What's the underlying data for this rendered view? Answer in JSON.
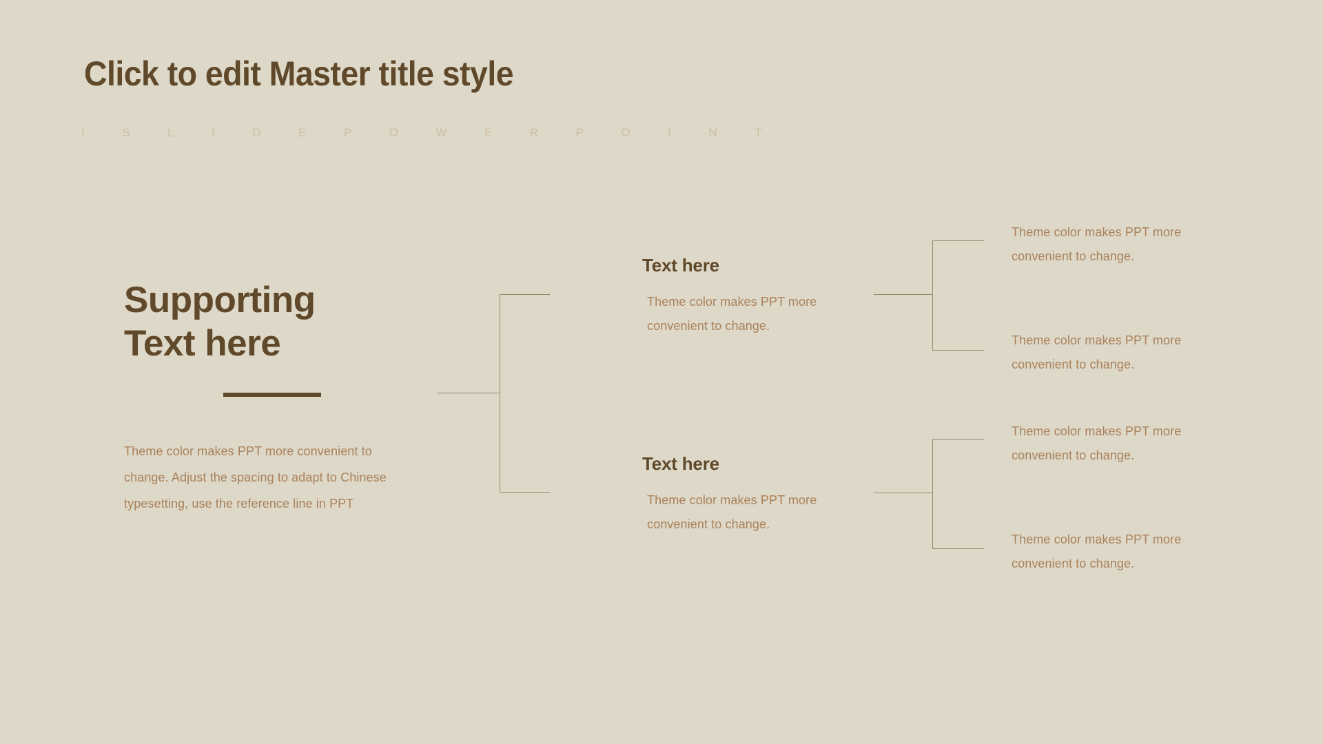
{
  "slide": {
    "background_color": "#ded8c8",
    "title": "Click to edit Master title style",
    "brand_letters": "ISLIDEPOWERPOINT"
  },
  "colors": {
    "heading": "#5f492a",
    "body": "#a9825c",
    "brand_letters": "#cdbda4",
    "connector_line": "#97896b"
  },
  "hero": {
    "title_line_1": "Supporting",
    "title_line_2": "Text here",
    "body": "Theme color makes PPT more convenient to change. Adjust the spacing to adapt to Chinese typesetting, use the reference line in PPT"
  },
  "mid_blocks": [
    {
      "title": "Text here",
      "body": "Theme color makes PPT more convenient to change."
    },
    {
      "title": "Text here",
      "body": "Theme color makes PPT more convenient to change."
    }
  ],
  "right_blocks": [
    {
      "body": "Theme color makes PPT more convenient to change."
    },
    {
      "body": "Theme color makes PPT more convenient to change."
    },
    {
      "body": "Theme color makes PPT more convenient to change."
    },
    {
      "body": "Theme color makes PPT more convenient to change."
    }
  ]
}
